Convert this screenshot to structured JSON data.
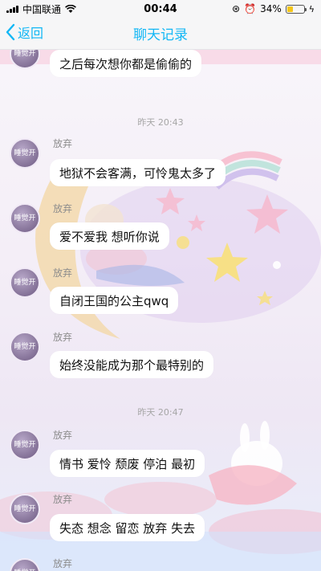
{
  "status_bar": {
    "carrier": "中国联通",
    "time": "00:44",
    "battery_percent": "34%",
    "battery_level": 0.34
  },
  "nav": {
    "back_label": "返回",
    "title": "聊天记录"
  },
  "avatar_text": "睡觉开",
  "timestamps": [
    "昨天 20:43",
    "昨天 20:47"
  ],
  "messages": [
    {
      "sender": "",
      "text": "之后每次想你都是偷偷的"
    },
    {
      "sender": "放弃",
      "text": "地狱不会客满，可怜鬼太多了"
    },
    {
      "sender": "放弃",
      "text": "爱不爱我 想听你说"
    },
    {
      "sender": "放弃",
      "text": "自闭王国的公主qwq"
    },
    {
      "sender": "放弃",
      "text": "始终没能成为那个最特别的"
    },
    {
      "sender": "放弃",
      "text": "情书  爱怜  颓废  停泊  最初"
    },
    {
      "sender": "放弃",
      "text": "失态  想念  留恋  放弃  失去"
    },
    {
      "sender": "放弃",
      "text": ""
    }
  ]
}
